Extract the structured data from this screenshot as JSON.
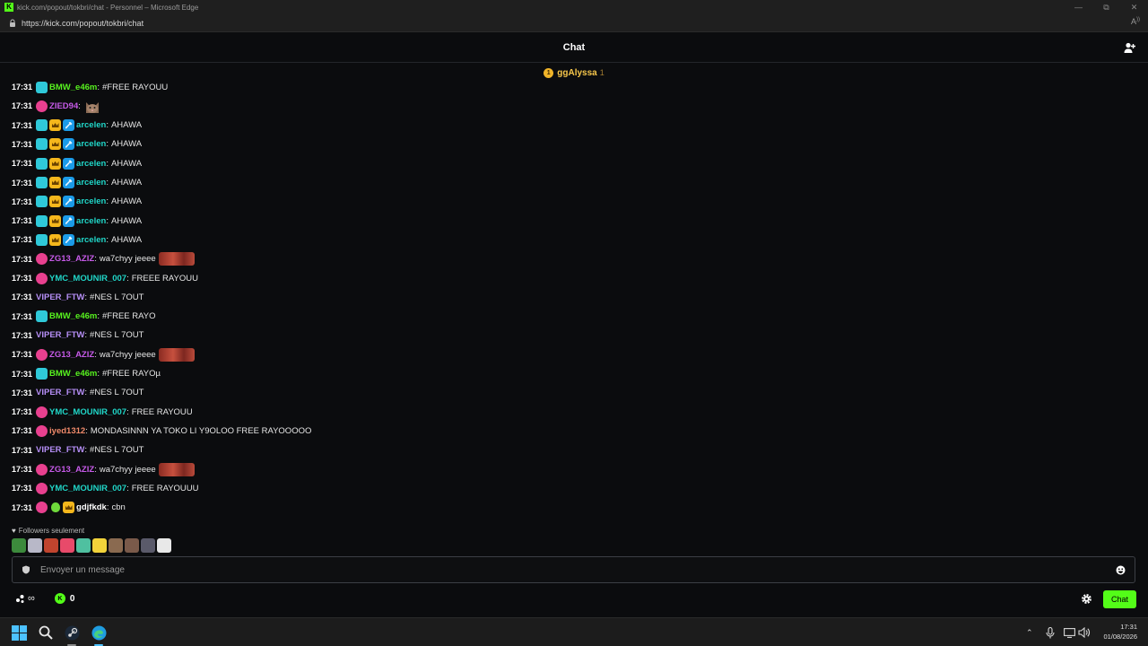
{
  "window": {
    "title": "kick.com/popout/tokbri/chat - Personnel – Microsoft Edge",
    "url": "https://kick.com/popout/tokbri/chat"
  },
  "header": {
    "title": "Chat"
  },
  "pinned": {
    "medal_text": "1",
    "name": "ggAlyssa",
    "count": "1"
  },
  "messages": [
    {
      "time": "17:31",
      "user": "BMW_e46m",
      "color": "#57f21f",
      "text": "#FREE RAYOUU",
      "badges": [
        "sub-cyan"
      ],
      "emote": ""
    },
    {
      "time": "17:31",
      "user": "ZIED94",
      "color": "#c65ae8",
      "text": "",
      "badges": [
        "sub-pink"
      ],
      "emote": "cat"
    },
    {
      "time": "17:31",
      "user": "arcelen",
      "color": "#20d6c8",
      "text": "AHAWA",
      "badges": [
        "sub-cyan",
        "crown",
        "hammer"
      ],
      "emote": ""
    },
    {
      "time": "17:31",
      "user": "arcelen",
      "color": "#20d6c8",
      "text": "AHAWA",
      "badges": [
        "sub-cyan",
        "crown",
        "hammer"
      ],
      "emote": ""
    },
    {
      "time": "17:31",
      "user": "arcelen",
      "color": "#20d6c8",
      "text": "AHAWA",
      "badges": [
        "sub-cyan",
        "crown",
        "hammer"
      ],
      "emote": ""
    },
    {
      "time": "17:31",
      "user": "arcelen",
      "color": "#20d6c8",
      "text": "AHAWA",
      "badges": [
        "sub-cyan",
        "crown",
        "hammer"
      ],
      "emote": ""
    },
    {
      "time": "17:31",
      "user": "arcelen",
      "color": "#20d6c8",
      "text": "AHAWA",
      "badges": [
        "sub-cyan",
        "crown",
        "hammer"
      ],
      "emote": ""
    },
    {
      "time": "17:31",
      "user": "arcelen",
      "color": "#20d6c8",
      "text": "AHAWA",
      "badges": [
        "sub-cyan",
        "crown",
        "hammer"
      ],
      "emote": ""
    },
    {
      "time": "17:31",
      "user": "arcelen",
      "color": "#20d6c8",
      "text": "AHAWA",
      "badges": [
        "sub-cyan",
        "crown",
        "hammer"
      ],
      "emote": ""
    },
    {
      "time": "17:31",
      "user": "ZG13_AZIZ",
      "color": "#c65ae8",
      "text": "wa7chyy jeeee",
      "badges": [
        "sub-pink"
      ],
      "emote": "pill"
    },
    {
      "time": "17:31",
      "user": "YMC_MOUNIR_007",
      "color": "#20d6c8",
      "text": "FREEE RAYOUU",
      "badges": [
        "sub-pink"
      ],
      "emote": ""
    },
    {
      "time": "17:31",
      "user": "VIPER_FTW",
      "color": "#b58ef5",
      "text": "#NES L 7OUT",
      "badges": [],
      "emote": ""
    },
    {
      "time": "17:31",
      "user": "BMW_e46m",
      "color": "#57f21f",
      "text": "#FREE RAYO",
      "badges": [
        "sub-cyan"
      ],
      "emote": ""
    },
    {
      "time": "17:31",
      "user": "VIPER_FTW",
      "color": "#b58ef5",
      "text": "#NES L 7OUT",
      "badges": [],
      "emote": ""
    },
    {
      "time": "17:31",
      "user": "ZG13_AZIZ",
      "color": "#c65ae8",
      "text": "wa7chyy jeeee",
      "badges": [
        "sub-pink"
      ],
      "emote": "pill"
    },
    {
      "time": "17:31",
      "user": "BMW_e46m",
      "color": "#57f21f",
      "text": "#FREE RAYOµ",
      "badges": [
        "sub-cyan"
      ],
      "emote": ""
    },
    {
      "time": "17:31",
      "user": "VIPER_FTW",
      "color": "#b58ef5",
      "text": "#NES L 7OUT",
      "badges": [],
      "emote": ""
    },
    {
      "time": "17:31",
      "user": "YMC_MOUNIR_007",
      "color": "#20d6c8",
      "text": "FREE RAYOUU",
      "badges": [
        "sub-pink"
      ],
      "emote": ""
    },
    {
      "time": "17:31",
      "user": "iyed1312",
      "color": "#f08a6a",
      "text": "MONDASINNN YA TOKO LI Y9OLOO FREE RAYOOOOO",
      "badges": [
        "sub-pink"
      ],
      "emote": ""
    },
    {
      "time": "17:31",
      "user": "VIPER_FTW",
      "color": "#b58ef5",
      "text": "#NES L 7OUT",
      "badges": [],
      "emote": ""
    },
    {
      "time": "17:31",
      "user": "ZG13_AZIZ",
      "color": "#c65ae8",
      "text": "wa7chyy jeeee",
      "badges": [
        "sub-pink"
      ],
      "emote": "pill"
    },
    {
      "time": "17:31",
      "user": "YMC_MOUNIR_007",
      "color": "#20d6c8",
      "text": "FREE RAYOUUU",
      "badges": [
        "sub-pink"
      ],
      "emote": ""
    },
    {
      "time": "17:31",
      "user": "gdjfkdk",
      "color": "#ffffff",
      "text": "cbn",
      "badges": [
        "sub-pink",
        "alien",
        "crown"
      ],
      "emote": ""
    }
  ],
  "followers_only": "Followers seulement",
  "emote_bar": [
    "#3c8a3c",
    "#b8b8c8",
    "#c0442e",
    "#e84a6a",
    "#4fc0a0",
    "#f2d33a",
    "#8a6a50",
    "#7a5a4a",
    "#5a5a6a",
    "#e8e8e8"
  ],
  "input": {
    "placeholder": "Envoyer un message"
  },
  "bottom": {
    "infinity": "∞",
    "coins": "0",
    "chat_button": "Chat"
  },
  "taskbar": {
    "time": "17:31",
    "date": "01/08/2026"
  }
}
